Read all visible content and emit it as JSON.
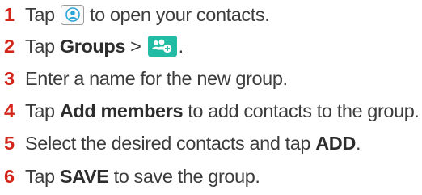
{
  "steps": [
    {
      "number": "1",
      "parts": [
        "Tap ",
        {
          "icon": "contacts-icon"
        },
        " to open your contacts."
      ]
    },
    {
      "number": "2",
      "parts": [
        "Tap ",
        {
          "bold": "Groups"
        },
        " > ",
        {
          "icon": "add-group-icon"
        },
        "."
      ]
    },
    {
      "number": "3",
      "parts": [
        "Enter a name for the new group."
      ]
    },
    {
      "number": "4",
      "parts": [
        "Tap ",
        {
          "bold": "Add members"
        },
        " to add contacts to the group."
      ]
    },
    {
      "number": "5",
      "parts": [
        "Select the desired contacts and tap ",
        {
          "bold": "ADD"
        },
        "."
      ]
    },
    {
      "number": "6",
      "parts": [
        "Tap ",
        {
          "bold": "SAVE"
        },
        " to save the group."
      ]
    }
  ],
  "colors": {
    "step_number": "#d3261a",
    "text": "#3c3c3c",
    "add_group_icon_bg": "#22bca4"
  }
}
